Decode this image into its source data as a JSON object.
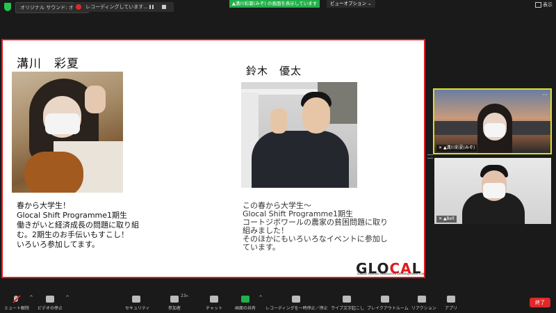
{
  "topbar": {
    "original_sound": "オリジナル サウンド: オフ",
    "recording": "レコーディングしています...",
    "share_banner": "▲溝川彩夏(みぞ) の画面を表示しています",
    "view_options": "ビューオプション ⌄",
    "display": "表示"
  },
  "slide": {
    "person1_name": "溝川　彩夏",
    "person1_desc": [
      "春から大学生！",
      "Glocal Shift Programme1期生",
      "働きがいと経済成長の問題に取り組",
      "む。2期生のお手伝いもすこし！",
      "いろいろ参加してます。"
    ],
    "person2_name": "鈴木　優太",
    "person2_desc": [
      "この春から大学生〜",
      "Glocal Shift Programme1期生",
      "コートジボワールの農家の貧困問題に取り",
      "組みました！",
      "そのほかにもいろいろなイベントに参加し",
      "ています。"
    ],
    "logo": {
      "left": "GLO",
      "mid": "CA",
      "right": "L"
    },
    "logo_sub": "Glocal Human Resources Development Center"
  },
  "participants": [
    {
      "label": "▲溝川彩夏(みぞ)",
      "active": true
    },
    {
      "label": "▲Bell"
    }
  ],
  "toolbar": {
    "mute": "ミュート解除",
    "video": "ビデオの停止",
    "security": "セキュリティ",
    "participants": "参加者",
    "participants_count": "23",
    "chat": "チャット",
    "share": "画面の共有",
    "recording": "レコーディングを一時停止／停止",
    "captions": "ライブ文字起こし",
    "breakout": "ブレイクアウトルーム",
    "reactions": "リアクション",
    "apps": "アプリ",
    "end": "終了"
  },
  "colors": {
    "accent_green": "#22b04b",
    "end_red": "#e02828",
    "slide_border": "#e21b1b",
    "active_speaker": "#d8e02a"
  }
}
